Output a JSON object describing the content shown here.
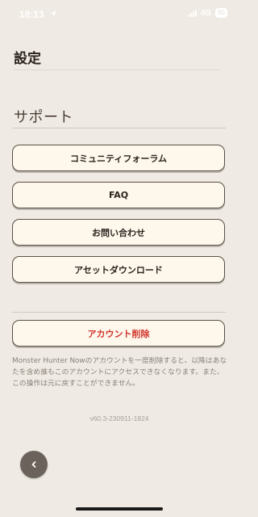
{
  "status_bar": {
    "time": "18:13",
    "network": "4G",
    "battery": "80"
  },
  "header": {
    "title": "設定"
  },
  "support": {
    "section_title": "サポート",
    "buttons": [
      {
        "label": "コミュニティフォーラム"
      },
      {
        "label": "FAQ"
      },
      {
        "label": "お問い合わせ"
      },
      {
        "label": "アセットダウンロード"
      }
    ]
  },
  "account": {
    "delete_label": "アカウント削除",
    "notice": "Monster Hunter Nowのアカウントを一度削除すると、以降はあなたを含め誰もこのアカウントにアクセスできなくなります。また、この操作は元に戻すことができません。"
  },
  "version": "v60.3-230911-1824",
  "colors": {
    "background": "#efebe4",
    "button_fill": "#fdf7ec",
    "danger": "#d1342b"
  },
  "icons": {
    "location": "location-arrow-icon",
    "back": "chevron-left-icon"
  }
}
